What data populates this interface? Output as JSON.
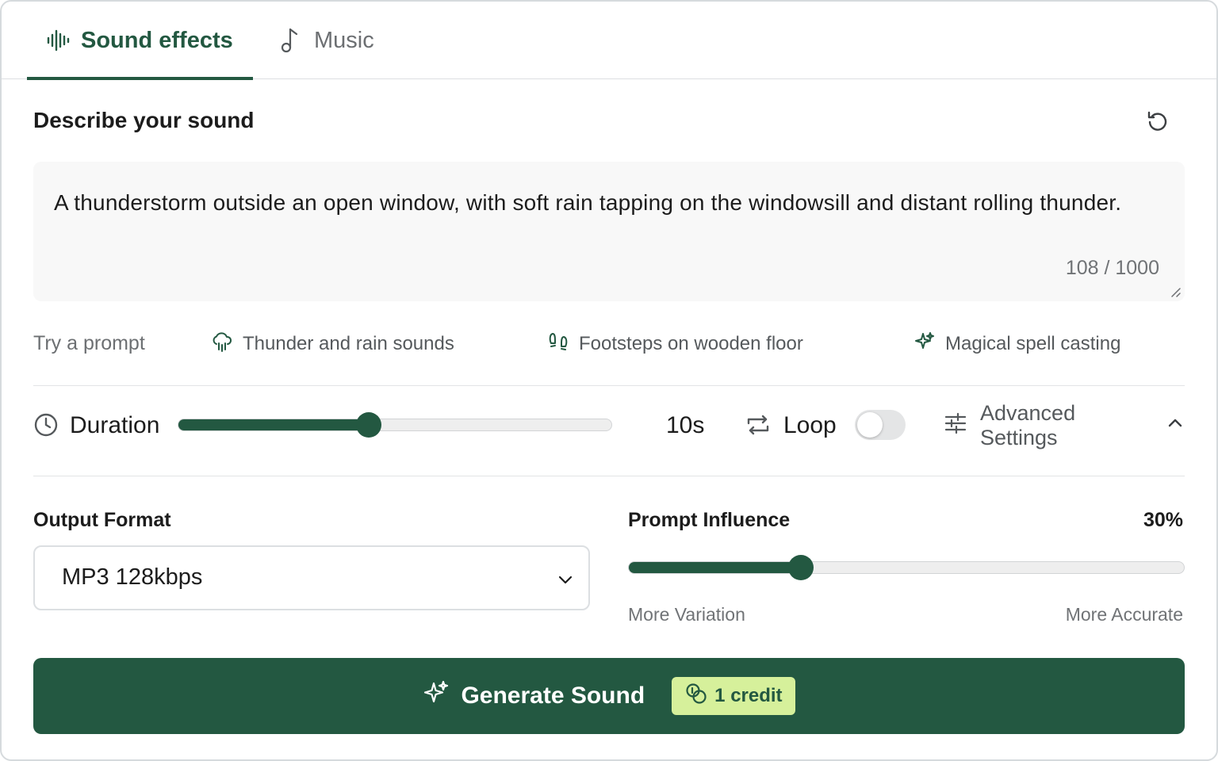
{
  "tabs": [
    {
      "label": "Sound effects",
      "icon": "waveform-icon",
      "active": true
    },
    {
      "label": "Music",
      "icon": "music-note-icon",
      "active": false
    }
  ],
  "section": {
    "title": "Describe your sound",
    "reset_icon": "reset-icon"
  },
  "prompt": {
    "value": "A thunderstorm outside an open window, with soft rain tapping on the windowsill and distant rolling thunder.",
    "char_count": "108 / 1000"
  },
  "try_prompt": {
    "label": "Try a prompt",
    "chips": [
      {
        "label": "Thunder and rain sounds",
        "icon": "cloud-rain-icon"
      },
      {
        "label": "Footsteps on wooden floor",
        "icon": "footprints-icon"
      },
      {
        "label": "Magical spell casting",
        "icon": "sparkles-icon"
      }
    ]
  },
  "controls": {
    "duration_label": "Duration",
    "duration_fraction": 0.44,
    "duration_value": "10s",
    "loop_label": "Loop",
    "loop_on": false,
    "advanced_label": "Advanced Settings"
  },
  "advanced": {
    "output_format_label": "Output Format",
    "output_format_value": "MP3 128kbps",
    "prompt_influence_label": "Prompt Influence",
    "prompt_influence_value": "30%",
    "prompt_influence_fraction": 0.31,
    "min_label": "More Variation",
    "max_label": "More Accurate"
  },
  "generate": {
    "label": "Generate Sound",
    "credit": "1 credit"
  },
  "colors": {
    "accent": "#235841",
    "badge": "#d6f09b",
    "muted": "#6c6f72"
  }
}
